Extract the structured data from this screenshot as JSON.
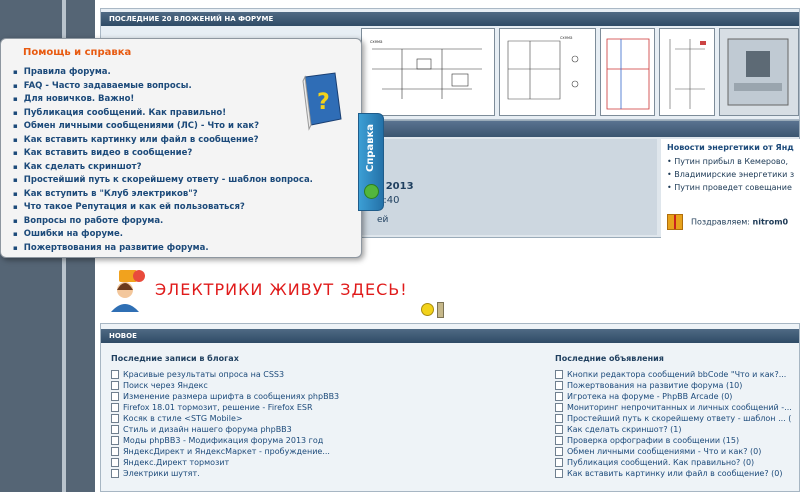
{
  "forum": {
    "attachments_header": "ПОСЛЕДНИЕ 20 ВЛОЖЕНИЙ НА ФОРУМЕ",
    "info": {
      "date": "г 2013",
      "time": "3:40",
      "extra": "ей"
    },
    "news": {
      "title": "Новости энергетики от Янд",
      "items": [
        "Путин прибыл в Кемерово,",
        "Владимирские энергетики з",
        "Путин проведет совещание"
      ],
      "congrats_label": "Поздравляем:",
      "congrats_user": "nitrom0"
    },
    "slogan": "ЭЛЕКТРИКИ ЖИВУТ ЗДЕСЬ!",
    "new_header": "НОВОЕ",
    "blogs": {
      "title": "Последние записи в блогах",
      "items": [
        "Красивые результаты опроса на CSS3",
        "Поиск через Яндекс",
        "Изменение размера шрифта в сообщениях phpBB3",
        "Firefox 18.01 тормозит, решение - Firefox ESR",
        "Косяк в стиле <STG Mobile>",
        "Стиль и дизайн нашего форума phpBB3",
        "Моды phpBB3 - Модификация форума 2013 год",
        "ЯндексДирект и ЯндексМаркет - пробуждение...",
        "Яндекс.Директ тормозит",
        "Электрики шутят."
      ]
    },
    "ads": {
      "title": "Последние объявления",
      "items": [
        "Кнопки редактора сообщений bbCode \"Что и как?...",
        "Пожертвования на развитие форума (10)",
        "Игротека на форуме - PhpBB Arcade (0)",
        "Мониторинг непрочитанных и личных сообщений -...",
        "Простейший путь к скорейшему ответу - шаблон ... (",
        "Как сделать скриншот? (1)",
        "Проверка орфографии в сообщении (15)",
        "Обмен личными сообщениями - Что и как? (0)",
        "Публикация сообщений. Как правильно? (0)",
        "Как вставить картинку или файл в сообщение? (0)"
      ]
    }
  },
  "help": {
    "title": "Помощь и справка",
    "tab_label": "Справка",
    "items": [
      "Правила форума.",
      "FAQ - Часто задаваемые вопросы.",
      "Для новичков. Важно!",
      "Публикация сообщений. Как правильно!",
      "Обмен личными сообщениями (ЛС) - Что и как?",
      "Как вставить картинку или файл в сообщение?",
      "Как вставить видео в сообщение?",
      "Как сделать скриншот?",
      "Простейший путь к скорейшему ответу - шаблон вопроса.",
      "Как вступить в \"Клуб электриков\"?",
      "Что такое Репутация и как ей пользоваться?",
      "Вопросы по работе форума.",
      "Ошибки на форуме.",
      "Пожертвования на развитие форума."
    ]
  },
  "colors": {
    "accent": "#e85a10",
    "link": "#1c4a7a",
    "slogan": "#e01b1b",
    "header": "#2f4b66"
  },
  "icons": [
    "question-book-icon",
    "help-tab-icon",
    "gift-icon",
    "document-icon",
    "smiley-icon"
  ]
}
